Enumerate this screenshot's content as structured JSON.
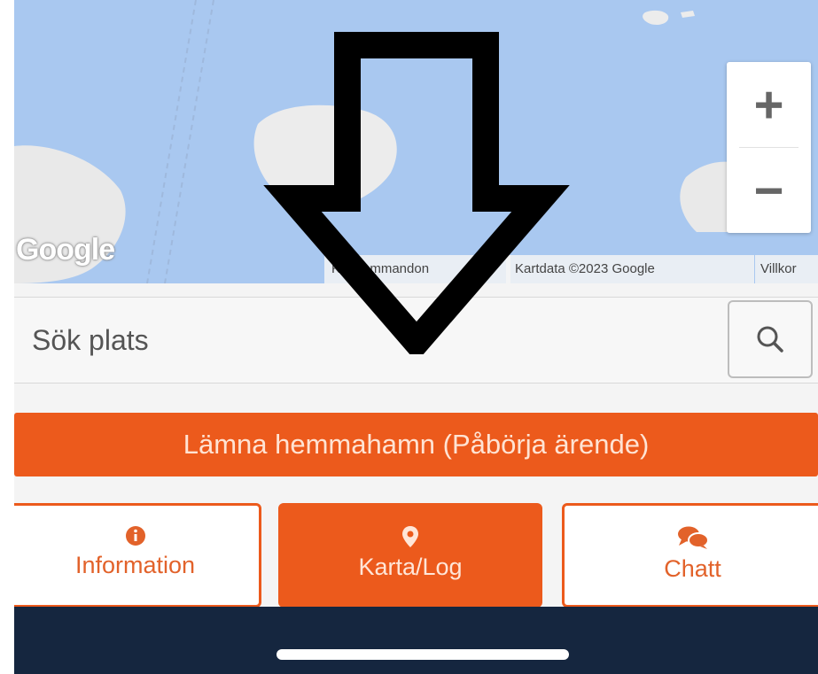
{
  "map": {
    "google_logo": "Google",
    "zoom_in_label": "+",
    "zoom_out_label": "−",
    "attribution_shortcuts": "Kortkommandon",
    "attribution_data": "Kartdata ©2023 Google",
    "attribution_terms": "Villkor",
    "colors": {
      "water": "#a9c8f0",
      "land": "#e9e9e9"
    }
  },
  "search": {
    "placeholder": "Sök plats",
    "icon": "search-icon"
  },
  "primary_action": {
    "label": "Lämna hemmahamn (Påbörja ärende)",
    "color": "#ec5a1c"
  },
  "tabs": [
    {
      "label": "Information",
      "icon": "info-icon",
      "active": false
    },
    {
      "label": "Karta/Log",
      "icon": "map-pin-icon",
      "active": true
    },
    {
      "label": "Chatt",
      "icon": "chat-bubbles-icon",
      "active": false
    }
  ],
  "bottom_bar": {
    "color": "#15263f"
  },
  "annotation": {
    "icon": "down-arrow-icon",
    "color": "#000000"
  }
}
